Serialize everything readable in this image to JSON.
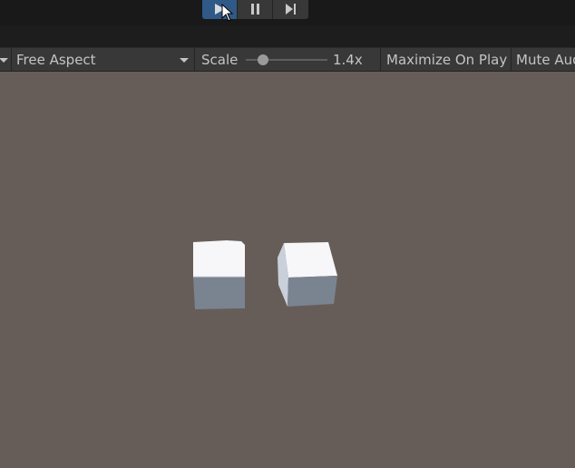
{
  "play_toolbar": {
    "play_icon": "play-icon",
    "pause_icon": "pause-icon",
    "step_icon": "step-icon",
    "play_active": true,
    "accent_color": "#2f5a88"
  },
  "game_toolbar": {
    "aspect_dropdown": "Free Aspect",
    "scale_label": "Scale",
    "scale_value": "1.4x",
    "maximize_label": "Maximize On Play",
    "mute_label": "Mute Audio"
  },
  "scene": {
    "background_color": "#675d58",
    "objects": [
      "cube",
      "cube"
    ]
  }
}
